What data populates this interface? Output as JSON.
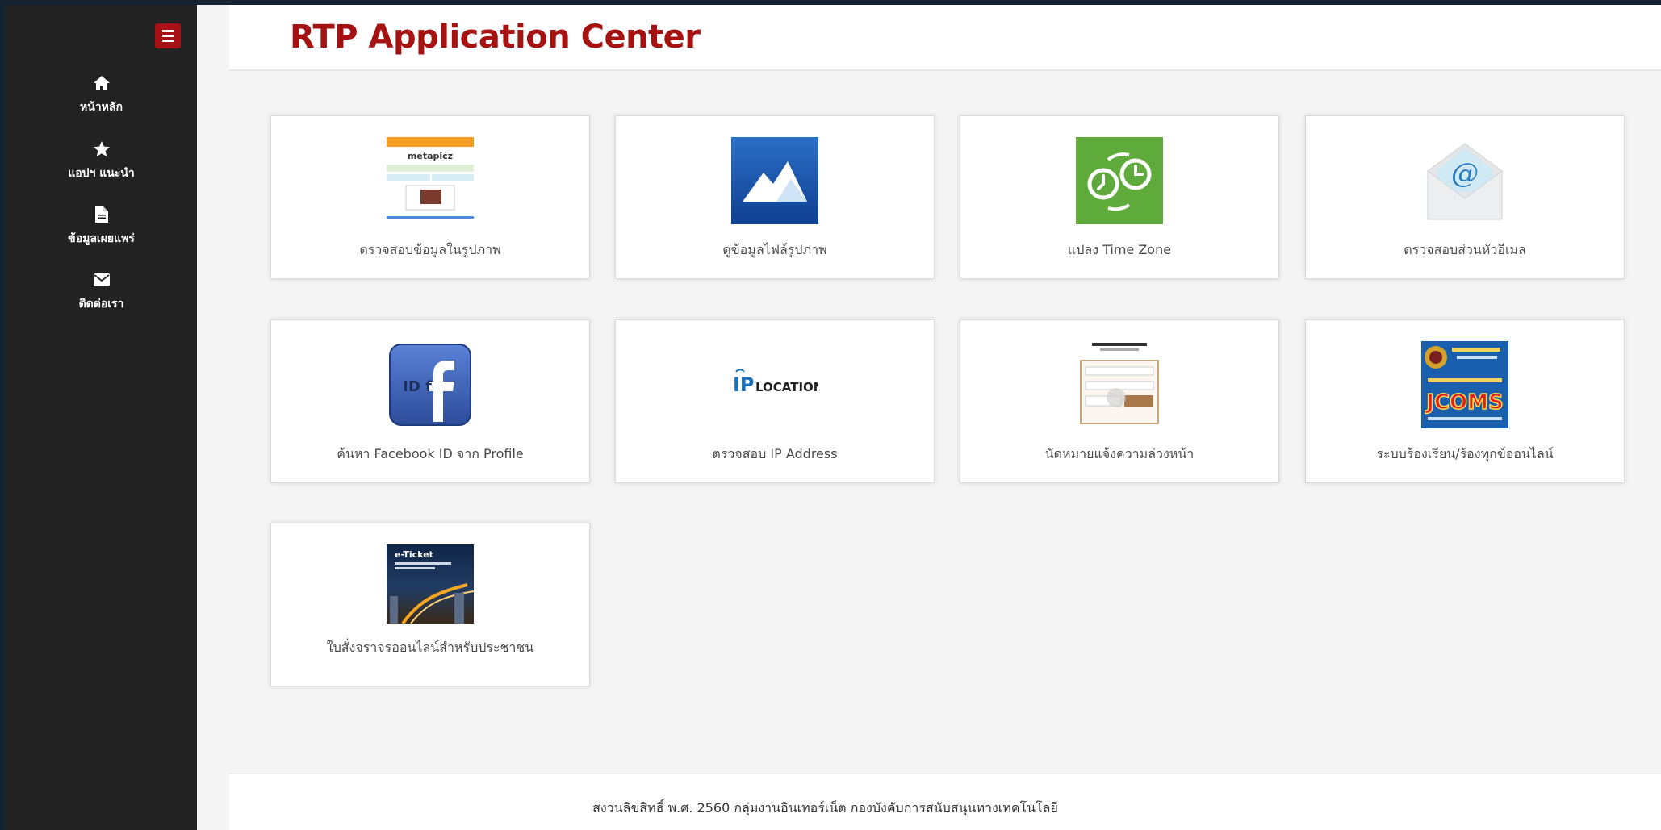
{
  "header": {
    "title": "RTP Application Center"
  },
  "sidebar": {
    "toggle_icon": "menu-icon",
    "items": [
      {
        "label": "หน้าหลัก",
        "icon": "home-icon"
      },
      {
        "label": "แอปฯ แนะนำ",
        "icon": "star-icon"
      },
      {
        "label": "ข้อมูลเผยแพร่",
        "icon": "file-icon"
      },
      {
        "label": "ติดต่อเรา",
        "icon": "envelope-icon"
      }
    ]
  },
  "apps": [
    {
      "label": "ตรวจสอบข้อมูลในรูปภาพ",
      "thumb_text": "metapicz"
    },
    {
      "label": "ดูข้อมูลไฟล์รูปภาพ"
    },
    {
      "label": "แปลง Time Zone"
    },
    {
      "label": "ตรวจสอบส่วนหัวอีเมล",
      "thumb_text": "@"
    },
    {
      "label": "ค้นหา Facebook ID จาก Profile",
      "thumb_text": "ID f"
    },
    {
      "label": "ตรวจสอบ IP Address",
      "thumb_text": "LOCATION",
      "thumb_prefix": "IP"
    },
    {
      "label": "นัดหมายแจ้งความล่วงหน้า"
    },
    {
      "label": "ระบบร้องเรียน/ร้องทุกข์ออนไลน์",
      "thumb_text": "JCOMS"
    },
    {
      "label": "ใบสั่งจราจรออนไลน์สำหรับประชาชน",
      "thumb_text": "e-Ticket"
    }
  ],
  "footer": {
    "text": "สงวนลิขสิทธิ์ พ.ศ. 2560 กลุ่มงานอินเทอร์เน็ต กองบังคับการสนับสนุนทางเทคโนโลยี"
  },
  "colors": {
    "brand_red": "#a51212",
    "sidebar_bg": "#222222",
    "toggle_bg": "#a71014"
  }
}
